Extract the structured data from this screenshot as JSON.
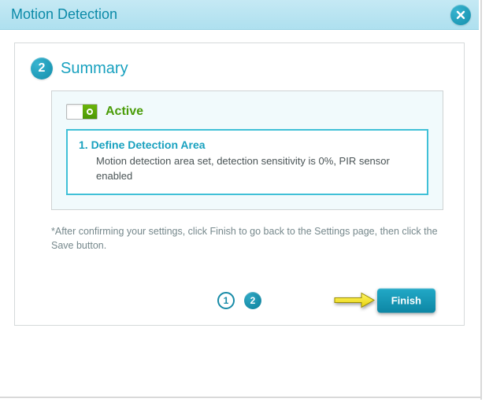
{
  "dialog": {
    "title": "Motion Detection",
    "close_icon": "close-icon"
  },
  "wizard": {
    "current_step_number": "2",
    "heading": "Summary"
  },
  "status": {
    "switch_on": true,
    "label": "Active"
  },
  "step_box": {
    "title": "1. Define Detection Area",
    "description": "Motion detection area set, detection sensitivity is 0%, PIR sensor enabled"
  },
  "note": "*After confirming your settings, click Finish to go back to the Settings page, then click the Save button.",
  "pager": {
    "step1": "1",
    "step2": "2"
  },
  "finish_button": "Finish"
}
